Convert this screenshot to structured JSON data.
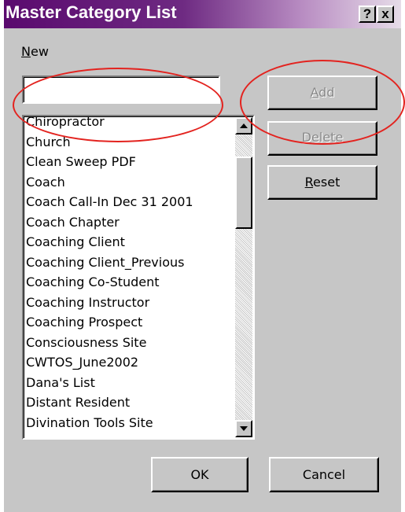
{
  "dialog": {
    "title": "Master Category List",
    "help_label": "?",
    "close_label": "x"
  },
  "new_field": {
    "label_mnemonic": "N",
    "label_rest": "ew",
    "value": "",
    "placeholder": ""
  },
  "buttons": {
    "add": {
      "mnemonic": "A",
      "rest": "dd",
      "enabled": false
    },
    "delete": {
      "mnemonic": "D",
      "rest": "elete",
      "enabled": false
    },
    "reset": {
      "mnemonic": "R",
      "rest": "eset",
      "enabled": true
    },
    "ok": "OK",
    "cancel": "Cancel"
  },
  "categories": [
    "Chiropractor",
    "Church",
    "Clean Sweep PDF",
    "Coach",
    "Coach Call-In Dec 31 2001",
    "Coach Chapter",
    "Coaching Client",
    "Coaching Client_Previous",
    "Coaching Co-Student",
    "Coaching Instructor",
    "Coaching Prospect",
    "Consciousness Site",
    "CWTOS_June2002",
    "Dana's List",
    "Distant Resident",
    "Divination Tools Site"
  ],
  "colors": {
    "title_gradient_start": "#5a0a6e",
    "dialog_face": "#c6c6c6",
    "annotation": "#e3231f"
  }
}
